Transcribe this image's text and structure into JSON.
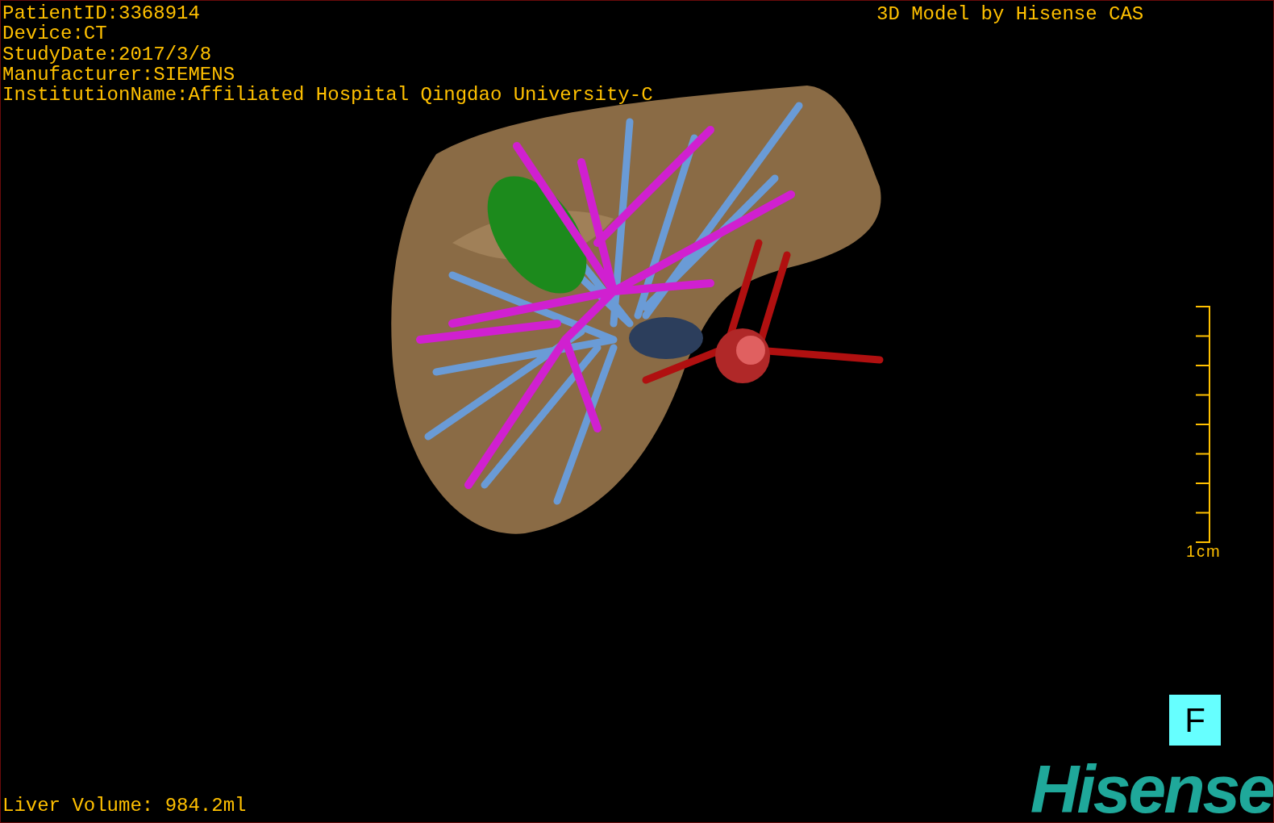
{
  "patient_info": [
    "PatientID:3368914",
    "Device:CT",
    "StudyDate:2017/3/8",
    "Manufacturer:SIEMENS",
    "InstitutionName:Affiliated Hospital Qingdao University-C"
  ],
  "title": "3D Model by Hisense CAS",
  "scale_bar": {
    "label": "1cm"
  },
  "orientation_marker": "F",
  "liver_volume": "Liver Volume: 984.2ml",
  "logo": "Hisense"
}
